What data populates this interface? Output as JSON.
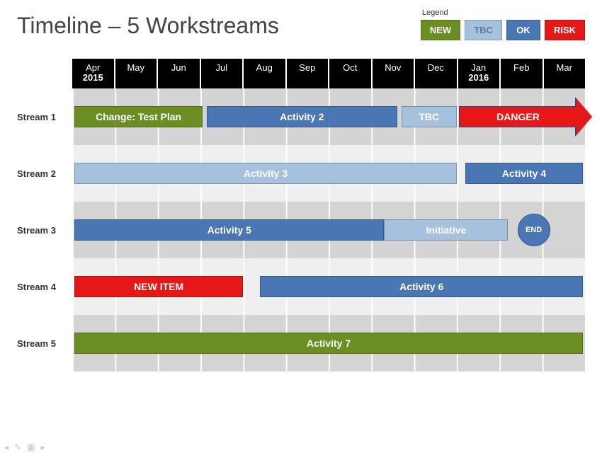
{
  "title": "Timeline – 5 Workstreams",
  "legend": {
    "label": "Legend",
    "items": [
      {
        "label": "NEW",
        "cls": "clr-new"
      },
      {
        "label": "TBC",
        "cls": "clr-tbc"
      },
      {
        "label": "OK",
        "cls": "clr-ok"
      },
      {
        "label": "RISK",
        "cls": "clr-risk"
      }
    ]
  },
  "months": [
    {
      "m": "Apr",
      "y": "2015"
    },
    {
      "m": "May"
    },
    {
      "m": "Jun"
    },
    {
      "m": "Jul"
    },
    {
      "m": "Aug"
    },
    {
      "m": "Sep"
    },
    {
      "m": "Oct"
    },
    {
      "m": "Nov"
    },
    {
      "m": "Dec"
    },
    {
      "m": "Jan",
      "y": "2016"
    },
    {
      "m": "Feb"
    },
    {
      "m": "Mar"
    }
  ],
  "streams": [
    {
      "name": "Stream 1",
      "items": [
        {
          "kind": "bar",
          "label": "Change: Test Plan",
          "cls": "clr-new",
          "start": 0.05,
          "end": 3.05
        },
        {
          "kind": "bar",
          "label": "Activity 2",
          "cls": "clr-ok",
          "start": 3.15,
          "end": 7.6
        },
        {
          "kind": "bar",
          "label": "TBC",
          "cls": "clr-tbc",
          "start": 7.7,
          "end": 9.0
        },
        {
          "kind": "arrow",
          "label": "DANGER",
          "cls": "clr-risk",
          "start": 9.05,
          "end": 12.1
        }
      ]
    },
    {
      "name": "Stream 2",
      "items": [
        {
          "kind": "bar",
          "label": "Activity 3",
          "cls": "clr-tbc",
          "start": 0.05,
          "end": 9.0
        },
        {
          "kind": "bar",
          "label": "Activity 4",
          "cls": "clr-ok",
          "start": 9.2,
          "end": 11.95
        }
      ]
    },
    {
      "name": "Stream 3",
      "items": [
        {
          "kind": "bar",
          "label": "Activity 5",
          "cls": "clr-ok",
          "start": 0.05,
          "end": 7.3
        },
        {
          "kind": "bar",
          "label": "Initiative",
          "cls": "clr-tbc",
          "start": 7.3,
          "end": 10.2
        },
        {
          "kind": "circle",
          "label": "END",
          "at": 10.8
        }
      ]
    },
    {
      "name": "Stream 4",
      "items": [
        {
          "kind": "bar",
          "label": "NEW ITEM",
          "cls": "clr-risk",
          "start": 0.05,
          "end": 4.0
        },
        {
          "kind": "bar",
          "label": "Activity 6",
          "cls": "clr-ok",
          "start": 4.4,
          "end": 11.95
        }
      ]
    },
    {
      "name": "Stream 5",
      "items": [
        {
          "kind": "bar",
          "label": "Activity 7",
          "cls": "clr-new",
          "start": 0.05,
          "end": 11.95
        }
      ]
    }
  ]
}
